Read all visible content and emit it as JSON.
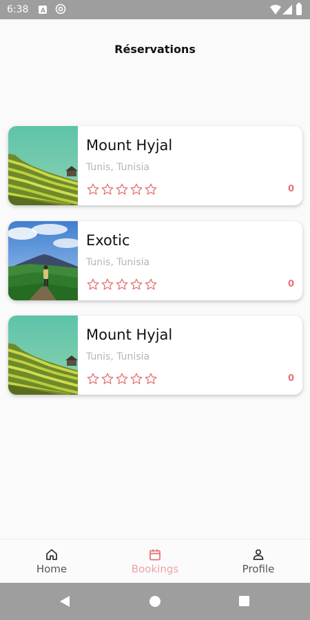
{
  "status_bar": {
    "time": "6:38"
  },
  "page": {
    "title": "Réservations"
  },
  "theme": {
    "accent": "#e57373",
    "active_nav": "#f1a2a4"
  },
  "bookings": [
    {
      "title": "Mount Hyjal",
      "location": "Tunis, Tunisia",
      "rating": 0,
      "max_rating": 5,
      "count": "0",
      "image": "rice-terraces"
    },
    {
      "title": "Exotic",
      "location": "Tunis, Tunisia",
      "rating": 0,
      "max_rating": 5,
      "count": "0",
      "image": "hiker-volcano"
    },
    {
      "title": "Mount Hyjal",
      "location": "Tunis, Tunisia",
      "rating": 0,
      "max_rating": 5,
      "count": "0",
      "image": "rice-terraces"
    }
  ],
  "bottom_nav": {
    "items": [
      {
        "label": "Home",
        "icon": "home-icon",
        "active": false
      },
      {
        "label": "Bookings",
        "icon": "calendar-icon",
        "active": true
      },
      {
        "label": "Profile",
        "icon": "person-icon",
        "active": false
      }
    ]
  }
}
